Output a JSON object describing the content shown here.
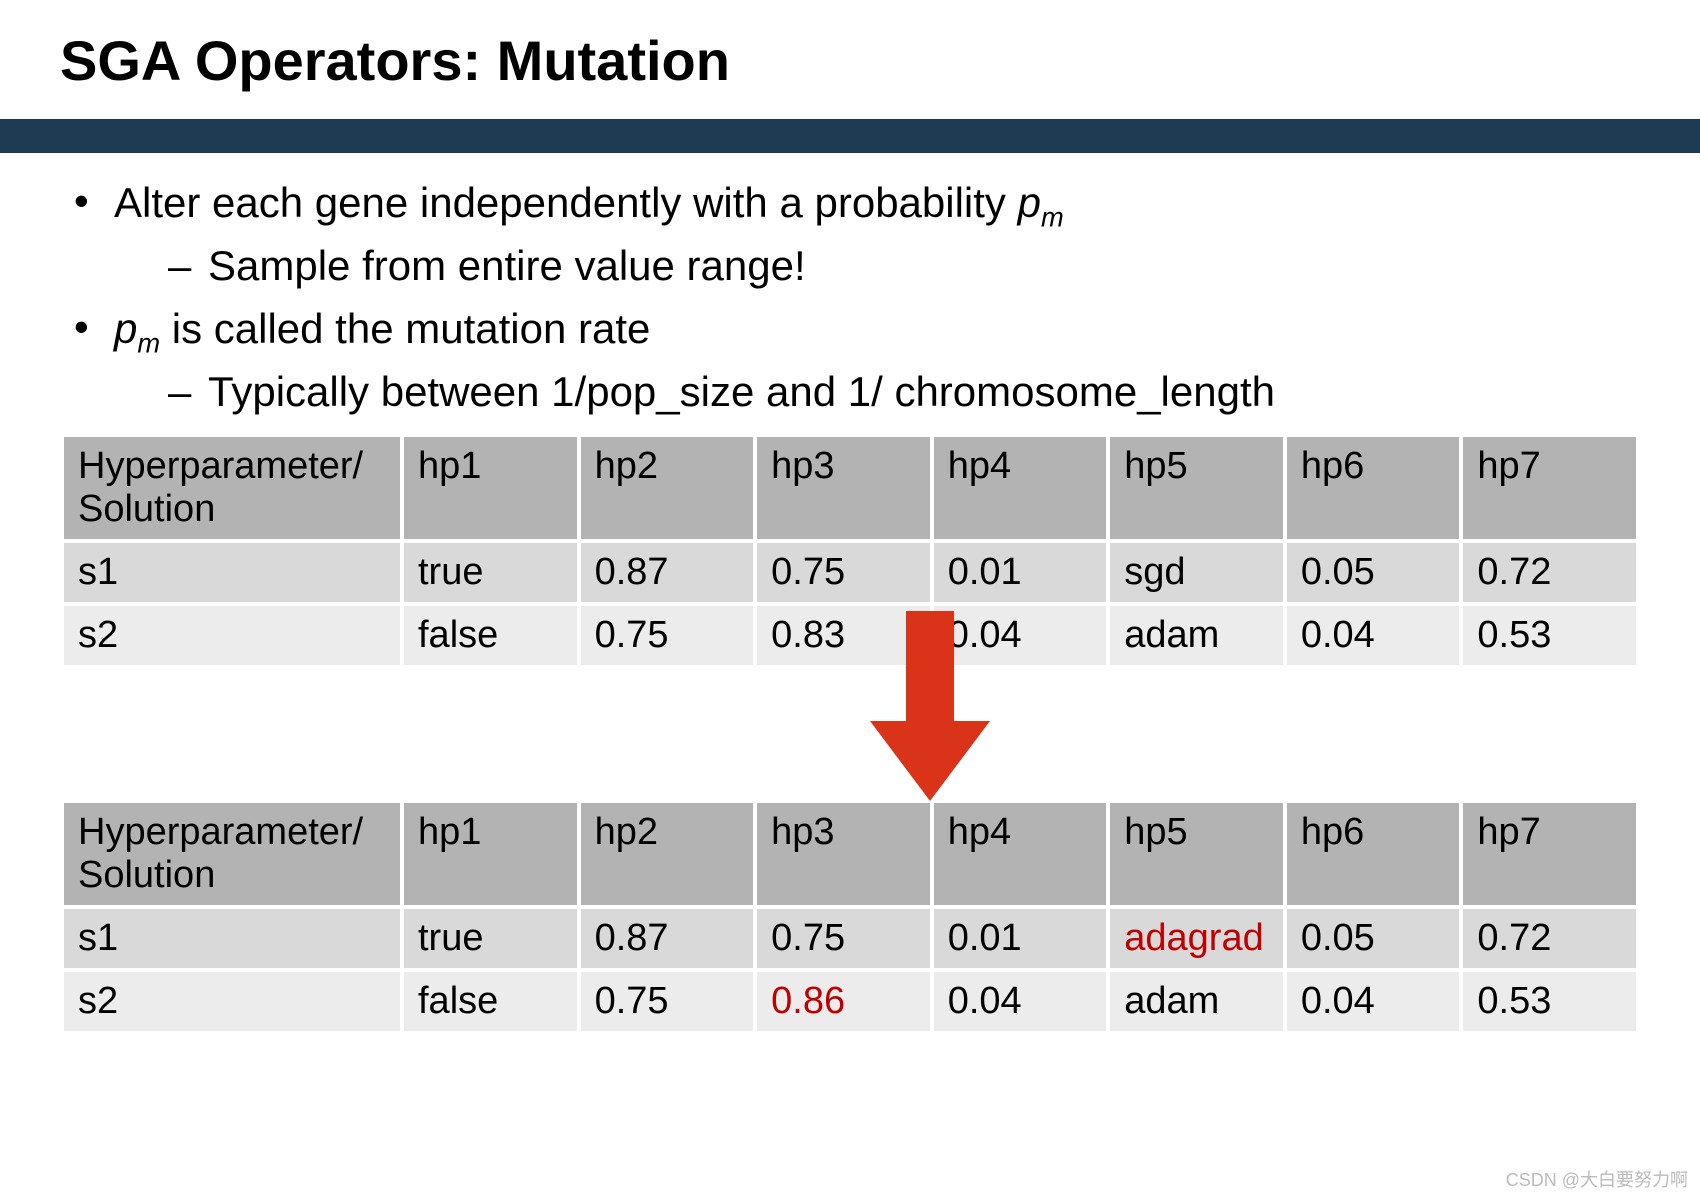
{
  "title": "SGA Operators: Mutation",
  "bullets": {
    "b1_pre": "Alter each gene independently with a probability ",
    "b1_pm_p": "p",
    "b1_pm_m": "m",
    "b1_sub": "Sample from entire value range!",
    "b2_pm_p": "p",
    "b2_pm_m": "m",
    "b2_post": " is called the mutation rate",
    "b2_sub": "Typically between 1/pop_size and 1/ chromosome_length"
  },
  "headers": [
    "Hyperparameter/ Solution",
    "hp1",
    "hp2",
    "hp3",
    "hp4",
    "hp5",
    "hp6",
    "hp7"
  ],
  "table1": {
    "rows": [
      [
        "s1",
        "true",
        "0.87",
        "0.75",
        "0.01",
        "sgd",
        "0.05",
        "0.72"
      ],
      [
        "s2",
        "false",
        "0.75",
        "0.83",
        "0.04",
        "adam",
        "0.04",
        "0.53"
      ]
    ]
  },
  "table2": {
    "rows": [
      [
        "s1",
        "true",
        "0.87",
        "0.75",
        "0.01",
        "adagrad",
        "0.05",
        "0.72"
      ],
      [
        "s2",
        "false",
        "0.75",
        "0.86",
        "0.04",
        "adam",
        "0.04",
        "0.53"
      ]
    ],
    "highlight": [
      [
        0,
        5
      ],
      [
        1,
        3
      ]
    ]
  },
  "arrow_color": "#d93419",
  "watermark": "CSDN @大白要努力啊"
}
